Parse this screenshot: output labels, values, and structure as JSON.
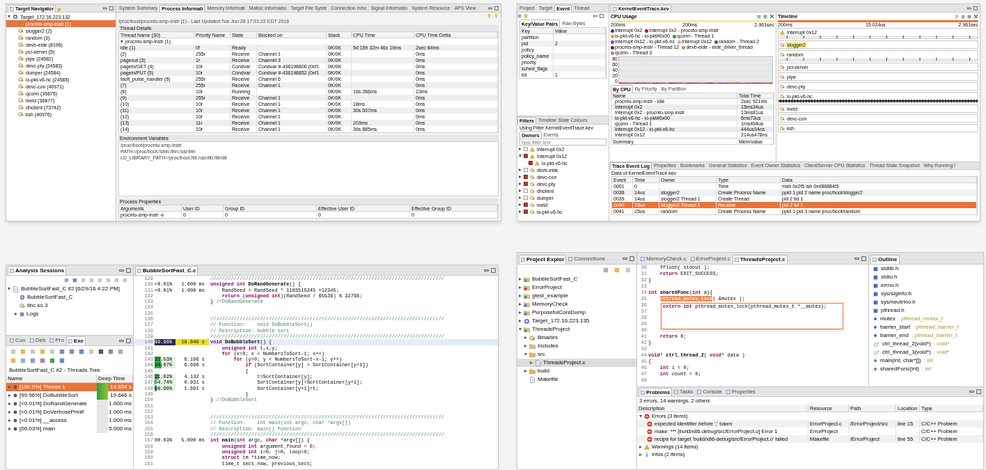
{
  "screen_1": {
    "navigator": {
      "tab": {
        "label": "Target Navigator",
        "selected": true
      },
      "tree": [
        {
          "label": "Target_172.16.223.132",
          "kind": "target",
          "expanded": true,
          "selected": false,
          "children": [
            {
              "label": "procnto-smp-instr (1)",
              "kind": "process",
              "selected": true
            },
            {
              "label": "slogger2 (2)",
              "kind": "process",
              "selected": false
            },
            {
              "label": "random (3)",
              "kind": "process",
              "selected": false
            },
            {
              "label": "devb-eide (8196)",
              "kind": "process",
              "selected": false
            },
            {
              "label": "pci-server (5)",
              "kind": "process",
              "selected": false
            },
            {
              "label": "pipe (24582)",
              "kind": "process",
              "selected": false
            },
            {
              "label": "devc-pty (24583)",
              "kind": "process",
              "selected": false
            },
            {
              "label": "dumper (24584)",
              "kind": "process",
              "selected": false
            },
            {
              "label": "io-pkt-v6-hc (24585)",
              "kind": "process",
              "selected": false
            },
            {
              "label": "devc-con (40971)",
              "kind": "process",
              "selected": false
            },
            {
              "label": "qconn (36876)",
              "kind": "process",
              "selected": false
            },
            {
              "label": "inetd (36877)",
              "kind": "process",
              "selected": false
            },
            {
              "label": "dhclient (73742)",
              "kind": "process",
              "selected": false
            },
            {
              "label": "ksh (40976)",
              "kind": "process",
              "selected": false
            }
          ]
        }
      ]
    },
    "tabs": [
      {
        "label": "System Summary",
        "selected": false
      },
      {
        "label": "Process Informati",
        "selected": true
      },
      {
        "label": "Memory Informati",
        "selected": false
      },
      {
        "label": "Malloc Informatio",
        "selected": false
      },
      {
        "label": "Target File Syste",
        "selected": false
      },
      {
        "label": "Connection Infor",
        "selected": false
      },
      {
        "label": "Signal Informatio",
        "selected": false
      },
      {
        "label": "System Resource",
        "selected": false
      },
      {
        "label": "APS View",
        "selected": false
      }
    ],
    "path": "/proc/boot/procnto-smp-instr (1) - Last Updated:Tue Jun 28 17:01:22 EDT 2016",
    "thread_details": {
      "title": "Thread Details",
      "columns": [
        "Thread Name (30)",
        "Priority Name",
        "State",
        "Blocked on",
        "Stack",
        "CPU Time",
        "CPU Time Delta"
      ],
      "group": {
        "label": "procnto-smp-instr (1)",
        "expanded": true
      },
      "rows": [
        [
          "idle (1)",
          "0f",
          "Ready",
          null,
          "0K/0K",
          "5d 15h 32m 46s 19ms",
          "2sec 84ms"
        ],
        [
          "(2)",
          "255r",
          "Receive",
          "Channel 1",
          "0K/0K",
          null,
          "0ms"
        ],
        [
          "pageout (3)",
          "1r",
          "Receive",
          "Channel 3",
          "0K/0K",
          null,
          "0ms"
        ],
        [
          "pagein/GET (4)",
          "10r",
          "Condvar",
          "Condvar #-436198800 (0xf1",
          "0K/0K",
          null,
          "0ms"
        ],
        [
          "pagein/PUT (5)",
          "10r",
          "Condvar",
          "Condvar #-436198852 (0xf1",
          "0K/0K",
          null,
          "0ms"
        ],
        [
          "fault_pulse_handler (6)",
          "255r",
          "Receive",
          "Channel 6",
          "0K/0K",
          null,
          "0ms"
        ],
        [
          "(7)",
          "255r",
          "Receive",
          "Channel 1",
          "0K/0K",
          null,
          "0ms"
        ],
        [
          "(8)",
          "10r",
          "Running",
          null,
          "0K/0K",
          "16s 286ms",
          "23ms"
        ],
        [
          "(9)",
          "255r",
          "Receive",
          "Channel 1",
          "0K/0K",
          null,
          "0ms"
        ],
        [
          "(10)",
          "10r",
          "Receive",
          "Channel 1",
          "0K/0K",
          "18ms",
          "0ms"
        ],
        [
          "(11)",
          "10r",
          "Receive",
          "Channel 1",
          "0K/0K",
          "30s 537ms",
          "0ms"
        ],
        [
          "(12)",
          "10r",
          "Receive",
          "Channel 1",
          "0K/0K",
          null,
          "0ms"
        ],
        [
          "(13)",
          "11r",
          "Receive",
          "Channel 1",
          "0K/0K",
          "203ms",
          "0ms"
        ],
        [
          "(14)",
          "10r",
          "Receive",
          "Channel 1",
          "0K/0K",
          "36s 885ms",
          "0ms"
        ]
      ]
    },
    "environment": {
      "title": "Environment Variables",
      "lines": [
        "/proc/boot/procnto-smp-instr",
        "PATH=/proc/boot:/sbin:/bin:/usr/bin",
        "LD_LIBRARY_PATH=/proc/boot:/lib:/usr/lib:/lib/dll"
      ]
    },
    "process_properties": {
      "title": "Process Properties",
      "columns": [
        "Arguments",
        "User ID",
        "Group ID",
        "Effective User ID",
        "Effective Group ID"
      ],
      "rows": [
        [
          "procnto-smp-instr -v",
          "0",
          "0",
          "0",
          "0"
        ]
      ]
    }
  },
  "screen_2": {
    "event_view": {
      "tabs": [
        {
          "label": "Project",
          "selected": false
        },
        {
          "label": "Target",
          "selected": false
        },
        {
          "label": "Event",
          "selected": true
        },
        {
          "label": "Thread",
          "selected": false
        }
      ],
      "subtabs": [
        {
          "label": "Key/Value Pairs",
          "selected": true
        },
        {
          "label": "Raw Bytes",
          "selected": false
        }
      ],
      "columns": [
        "Key",
        "Value"
      ],
      "rows": [
        [
          "partition",
          null
        ],
        [
          "pid",
          "2"
        ],
        [
          "policy",
          null
        ],
        [
          "policy_name",
          null
        ],
        [
          "priority",
          null
        ],
        [
          "sched_flags",
          null
        ],
        [
          "tid",
          "1"
        ]
      ]
    },
    "filters": {
      "tabs": [
        {
          "label": "Filters",
          "selected": true
        },
        {
          "label": "Timeline State Colours",
          "selected": false
        }
      ],
      "caption": "Using Filter KernelEventTrace.kev",
      "subtabs": [
        {
          "label": "Owners",
          "selected": true
        },
        {
          "label": "Events",
          "selected": false
        }
      ],
      "placeholder": "type filter text",
      "tree": [
        {
          "label": "Interrupt 0x2",
          "kind": "interrupt",
          "expanded": false,
          "checked": false
        },
        {
          "label": "Interrupt 0x12",
          "kind": "interrupt",
          "expanded": true,
          "checked": true,
          "children": [
            {
              "label": "io-pkt-v6-hc",
              "kind": "interrupt",
              "checked": true
            }
          ]
        },
        {
          "label": "devb-eide",
          "kind": "process",
          "expanded": false,
          "checked": false
        },
        {
          "label": "devc-con",
          "kind": "process",
          "expanded": false,
          "checked": true
        },
        {
          "label": "devc-pty",
          "kind": "process",
          "expanded": false,
          "checked": true
        },
        {
          "label": "dhclient",
          "kind": "process",
          "expanded": false,
          "checked": false
        },
        {
          "label": "dumper",
          "kind": "process",
          "expanded": false,
          "checked": false
        },
        {
          "label": "inetd",
          "kind": "process",
          "expanded": false,
          "checked": true
        },
        {
          "label": "io-pkt-v6-hc",
          "kind": "process",
          "expanded": false,
          "checked": true
        }
      ]
    },
    "editor_tab": {
      "label": "KernelEventTrace.kev",
      "selected": true
    },
    "cpu_usage": {
      "title": "CPU Usage",
      "axis": [
        "200ms",
        "200ms",
        "2.961sec"
      ],
      "legend": [
        {
          "name": "Interrupt 0x2",
          "color": "#2d3f9e"
        },
        {
          "name": "Interrupt 0x2 - procnto-smp-instr",
          "color": "#d0021b"
        },
        {
          "name": "io-pkt-v6-hc - io-pkt#0x00",
          "color": "#e8a317"
        },
        {
          "name": "qconn - Thread 1",
          "color": "#2e8b3a"
        },
        {
          "name": "Interrupt 0x12 - io-pkt-v6-hc",
          "color": "#8e3a9e"
        },
        {
          "name": "Interrupt 0x12",
          "color": "#e8a0b0"
        },
        {
          "name": "random - Thread 2",
          "color": "#555555"
        },
        {
          "name": "procnto-smp-instr - Thread 12",
          "color": "#5a1a8a"
        },
        {
          "name": "devb-eide - eide_driver_thread",
          "color": "#e8822a"
        },
        {
          "name": "qconn - Thread 3",
          "color": "#d9707a"
        }
      ],
      "y_labels": [
        "80",
        "60",
        "40",
        "20",
        "0"
      ],
      "tabs": [
        {
          "label": "By CPU",
          "selected": true
        },
        {
          "label": "By Priority",
          "selected": false
        },
        {
          "label": "By Partition",
          "selected": false
        }
      ],
      "columns": [
        "Name",
        "Total Time"
      ],
      "rows": [
        [
          "procnto-smp-instr - idle",
          "2sec 921ms"
        ],
        [
          "Interrupt 0x2",
          "15ms34us"
        ],
        [
          "Interrupt 0x2 - procnto-smp-instr",
          "13ms81us"
        ],
        [
          "io-pkt-v6-hc - io-pkt#0x00",
          "6ms73us"
        ],
        [
          "qconn - Thread 1",
          "1ms494us"
        ],
        [
          "Interrupt 0x12 - io-pkt-v6-hc",
          "444us34ns"
        ],
        [
          "Interrupt 0x12",
          "214us478ns"
        ]
      ],
      "summary": [
        "Summary",
        "Mem/value"
      ]
    },
    "timeline": {
      "title": "Timeline",
      "axis": [
        "200ms",
        "15.024us",
        "2.961sec"
      ],
      "rows": [
        {
          "label": "Interrupt 0x12",
          "kind": "interrupt",
          "events": {
            "dense": false
          },
          "highlighted": false
        },
        {
          "label": "slogger2",
          "kind": "process",
          "highlighted": true
        },
        {
          "label": "random",
          "kind": "process",
          "events": {
            "dense": false
          },
          "highlighted": false
        },
        {
          "label": "pci-server",
          "kind": "process",
          "highlighted": false
        },
        {
          "label": "pipe",
          "kind": "process",
          "highlighted": false
        },
        {
          "label": "devc-pty",
          "kind": "process",
          "highlighted": false
        },
        {
          "label": "io-pkt-v6-hc",
          "kind": "process",
          "events": {
            "dense": true
          },
          "highlighted": false
        },
        {
          "label": "inetd",
          "kind": "process",
          "highlighted": false
        },
        {
          "label": "devc-con",
          "kind": "process",
          "highlighted": false
        },
        {
          "label": "ksh",
          "kind": "process",
          "highlighted": false
        }
      ]
    },
    "trace_log": {
      "tabs": [
        {
          "label": "Trace Event Log",
          "selected": true
        },
        {
          "label": "Properties",
          "selected": false
        },
        {
          "label": "Bookmarks",
          "selected": false
        },
        {
          "label": "General Statistics",
          "selected": false
        },
        {
          "label": "Event Owner Statistics",
          "selected": false
        },
        {
          "label": "Client/Server CPU Statistics",
          "selected": false
        },
        {
          "label": "Thread State Snapshot",
          "selected": false
        },
        {
          "label": "Why Running?",
          "selected": false
        }
      ],
      "caption": "Data of KernelEventTrace.kev",
      "columns": [
        "Event",
        "Time",
        "Owner",
        "Type",
        "Data"
      ],
      "rows": [
        {
          "cells": [
            "0001",
            "0",
            null,
            "Time",
            "msb 0x2f5 lsb 0xd88884f3"
          ],
          "selected": false
        },
        {
          "cells": [
            "0038",
            "14us",
            "slogger2",
            "Create Process Name",
            "ppid 1 pid 2 name proc/boot/slogger2"
          ],
          "selected": false
        },
        {
          "cells": [
            "0039",
            "14us",
            "slogger2 Thread 1",
            "Create Thread",
            "pid 2 tid 1"
          ],
          "selected": false
        },
        {
          "cells": [
            "0040",
            "15us",
            "slogger2 Thread 1",
            "Receive",
            "pid 2 tid 1"
          ],
          "selected": true
        },
        {
          "cells": [
            "0041",
            "15us",
            "random",
            "Create Process Name",
            "ppid 1 pid 3 name proc/boot/random"
          ],
          "selected": false
        }
      ]
    }
  },
  "screen_3": {
    "sessions": {
      "tab": {
        "label": "Analysis Sessions",
        "selected": true
      },
      "tree": [
        {
          "label": "BubbleSortFast_C #2 [6/29/16 4:22 PM]",
          "kind": "session",
          "expanded": true,
          "children": [
            {
              "label": "BubbleSortFast_C",
              "kind": "binary"
            },
            {
              "label": "libc.so.3",
              "kind": "library"
            },
            {
              "label": "Logs",
              "kind": "logs",
              "expanded": false
            }
          ]
        }
      ]
    },
    "profiler": {
      "tabs": [
        {
          "label": "Con",
          "selected": false
        },
        {
          "label": "Deb",
          "selected": false
        },
        {
          "label": "Pro",
          "selected": false
        },
        {
          "label": "Exe",
          "selected": true
        }
      ],
      "caption": "BubbleSortFast_C #2 - Threads Tree",
      "columns": [
        "Name",
        "Deep Time"
      ],
      "rows": [
        {
          "label": "[100.0%] Thread 1",
          "time": "19.654 s",
          "level": 1,
          "selected": true,
          "expanded": false
        },
        {
          "label": "[99.96%] DoBubbleSort",
          "time": "19.646 s",
          "level": 0.9996,
          "selected": false,
          "expanded": false
        },
        {
          "label": "[<0.01%] DoRandGenerate",
          "time": "1.000 ms",
          "level": 0,
          "selected": false,
          "expanded": false
        },
        {
          "label": "[<0.01%] DoVerbosePrintf",
          "time": "1.000 ms",
          "level": 0,
          "selected": false,
          "expanded": false
        },
        {
          "label": "[<0.01%] __access",
          "time": "1.000 ms",
          "level": 0,
          "selected": false,
          "expanded": false
        },
        {
          "label": "[00.03%] main",
          "time": "5.000 ms",
          "level": 0,
          "selected": false,
          "expanded": false
        }
      ]
    },
    "editor": {
      "tab": {
        "label": "BubbleSortFast_C.c",
        "selected": true
      },
      "lines": [
        {
          "n": "129",
          "highlighted": false,
          "seg": [
            {
              "kind": "comment",
              "text": "////////////////////////////////////////////////////////////////////////////////"
            }
          ]
        },
        {
          "n": "130",
          "pct": "<0.01%",
          "time": "1.000 ms",
          "highlighted": false,
          "seg": [
            {
              "kind": "keyword",
              "text": "unsigned int "
            },
            {
              "kind": "name",
              "text": "DoRandGenerate"
            },
            {
              "kind": "plain",
              "text": "() {"
            }
          ]
        },
        {
          "n": "131",
          "pct": "<0.01%",
          "time": "1.000 ms",
          "highlighted": false,
          "seg": [
            {
              "kind": "plain",
              "text": "    RandSeed = RandSeed * 1103515245 +12345;"
            }
          ]
        },
        {
          "n": "132",
          "highlighted": false,
          "seg": [
            {
              "kind": "keyword",
              "text": "    return"
            },
            {
              "kind": "plain",
              "text": " ("
            },
            {
              "kind": "keyword",
              "text": "unsigned int"
            },
            {
              "kind": "plain",
              "text": ")(RandSeed / 65536) % 32768;"
            }
          ]
        },
        {
          "n": "133",
          "highlighted": false,
          "seg": [
            {
              "kind": "plain",
              "text": "} "
            },
            {
              "kind": "comment",
              "text": "//DoRandGenerate"
            }
          ]
        },
        {
          "n": "134",
          "highlighted": false
        },
        {
          "n": "135",
          "highlighted": false
        },
        {
          "n": "136",
          "highlighted": false,
          "seg": [
            {
              "kind": "comment",
              "text": "////////////////////////////////////////////////////////////////////////////////"
            }
          ]
        },
        {
          "n": "137",
          "highlighted": false,
          "seg": [
            {
              "kind": "comment",
              "text": "// Function:    void DoBubbleSort()"
            }
          ]
        },
        {
          "n": "138",
          "highlighted": false,
          "seg": [
            {
              "kind": "comment",
              "text": "// Description: bubble sort"
            }
          ]
        },
        {
          "n": "139",
          "highlighted": false,
          "seg": [
            {
              "kind": "comment",
              "text": "////////////////////////////////////////////////////////////////////////////////"
            }
          ]
        },
        {
          "n": "140",
          "pct": "99.96%",
          "time": "19.646 s",
          "level": 0.9996,
          "highlighted": true,
          "seg": [
            {
              "kind": "keyword",
              "text": "void "
            },
            {
              "kind": "name",
              "text": "DoBubbleSort"
            },
            {
              "kind": "plain",
              "text": "() {"
            }
          ]
        },
        {
          "n": "141",
          "highlighted": false,
          "seg": [
            {
              "kind": "keyword",
              "text": "    unsigned int"
            },
            {
              "kind": "plain",
              "text": " t,x,y;"
            }
          ]
        },
        {
          "n": "142",
          "highlighted": false,
          "seg": [
            {
              "kind": "keyword",
              "text": "    for"
            },
            {
              "kind": "plain",
              "text": " (x=0; x < NumbersToSort-1; x++)"
            }
          ]
        },
        {
          "n": "143",
          "pct": "31.53%",
          "time": "6.196 s",
          "level": 0.3153,
          "highlighted": false,
          "seg": [
            {
              "kind": "keyword",
              "text": "        for"
            },
            {
              "kind": "plain",
              "text": " (y=0; y < NumbersToSort-x-1; y++)"
            }
          ]
        },
        {
          "n": "144",
          "pct": "34.07%",
          "time": "6.696 s",
          "level": 0.3407,
          "highlighted": false,
          "seg": [
            {
              "kind": "keyword",
              "text": "            if"
            },
            {
              "kind": "plain",
              "text": " (SortContainer[y] > SortContainer[y+1])"
            }
          ]
        },
        {
          "n": "145",
          "highlighted": false,
          "seg": [
            {
              "kind": "plain",
              "text": "            {"
            }
          ]
        },
        {
          "n": "146",
          "pct": "21.02%",
          "time": "4.132 s",
          "level": 0.2102,
          "highlighted": false,
          "seg": [
            {
              "kind": "plain",
              "text": "                t=SortContainer[y];"
            }
          ]
        },
        {
          "n": "147",
          "pct": "04.74%",
          "time": "0.931 s",
          "level": 0.0474,
          "highlighted": false,
          "seg": [
            {
              "kind": "plain",
              "text": "                SortContainer[y]=SortContainer[y+1];"
            }
          ]
        },
        {
          "n": "148",
          "pct": "08.60%",
          "time": "1.691 s",
          "level": 0.086,
          "highlighted": false,
          "seg": [
            {
              "kind": "plain",
              "text": "                SortContainer[y+1]=t;"
            }
          ]
        },
        {
          "n": "149",
          "highlighted": false,
          "seg": [
            {
              "kind": "plain",
              "text": "            }"
            }
          ]
        },
        {
          "n": "150",
          "highlighted": false,
          "seg": [
            {
              "kind": "plain",
              "text": "} "
            },
            {
              "kind": "comment",
              "text": "//DoBubbleSort"
            }
          ]
        },
        {
          "n": "151",
          "highlighted": false
        },
        {
          "n": "152",
          "highlighted": false
        },
        {
          "n": "153",
          "highlighted": false,
          "seg": [
            {
              "kind": "comment",
              "text": "////////////////////////////////////////////////////////////////////////////////"
            }
          ]
        },
        {
          "n": "154",
          "highlighted": false,
          "seg": [
            {
              "kind": "comment",
              "text": "// Function:    int main(int argc, char *argv[])"
            }
          ]
        },
        {
          "n": "155",
          "highlighted": false,
          "seg": [
            {
              "kind": "comment",
              "text": "// Description: main() function"
            }
          ]
        },
        {
          "n": "156",
          "highlighted": false,
          "seg": [
            {
              "kind": "comment",
              "text": "////////////////////////////////////////////////////////////////////////////////"
            }
          ]
        },
        {
          "n": "157",
          "pct": "00.03%",
          "time": "5.000 ms",
          "highlighted": false,
          "seg": [
            {
              "kind": "keyword",
              "text": "int "
            },
            {
              "kind": "name",
              "text": "main"
            },
            {
              "kind": "plain",
              "text": "("
            },
            {
              "kind": "keyword",
              "text": "int"
            },
            {
              "kind": "plain",
              "text": " argc, "
            },
            {
              "kind": "keyword",
              "text": "char"
            },
            {
              "kind": "plain",
              "text": " *argv[]) {"
            }
          ]
        },
        {
          "n": "158",
          "highlighted": false,
          "seg": [
            {
              "kind": "keyword",
              "text": "    unsigned int"
            },
            {
              "kind": "plain",
              "text": " argument_found = 0;"
            }
          ]
        },
        {
          "n": "159",
          "highlighted": false,
          "seg": [
            {
              "kind": "keyword",
              "text": "    unsigned int"
            },
            {
              "kind": "plain",
              "text": " i=0, j=0, loop=0;"
            }
          ]
        },
        {
          "n": "160",
          "highlighted": false,
          "seg": [
            {
              "kind": "keyword",
              "text": "    struct"
            },
            {
              "kind": "plain",
              "text": " tm *time_now;"
            }
          ]
        },
        {
          "n": "161",
          "highlighted": false,
          "seg": [
            {
              "kind": "plain",
              "text": "    time_t secs_now, previous_secs;"
            }
          ]
        }
      ]
    }
  },
  "screen_4": {
    "explorer": {
      "tabs": [
        {
          "label": "Project Explor",
          "selected": true
        },
        {
          "label": "Connections",
          "selected": false
        }
      ],
      "tree": [
        {
          "label": "BubbleSortFast_C",
          "kind": "project",
          "expanded": false,
          "selected": false
        },
        {
          "label": "ErrorProject",
          "kind": "error_project",
          "expanded": false,
          "selected": false
        },
        {
          "label": "gtest_example",
          "kind": "project",
          "expanded": false,
          "selected": false
        },
        {
          "label": "MemoryCheck",
          "kind": "project",
          "expanded": false,
          "selected": false
        },
        {
          "label": "PurposefulCoreDump",
          "kind": "project",
          "expanded": false,
          "selected": false
        },
        {
          "label": "Target_172.16.223.135",
          "kind": "target",
          "expanded": false,
          "selected": false
        },
        {
          "label": "ThreadsProject",
          "kind": "project",
          "expanded": true,
          "selected": false,
          "children": [
            {
              "label": "Binaries",
              "kind": "binaries",
              "expanded": false,
              "selected": false
            },
            {
              "label": "Includes",
              "kind": "includes",
              "expanded": false,
              "selected": false
            },
            {
              "label": "src",
              "kind": "folder",
              "expanded": true,
              "selected": false,
              "children": [
                {
                  "label": "ThreadsProject.c",
                  "kind": "file",
                  "expanded": false,
                  "selected": true
                }
              ]
            },
            {
              "label": "build",
              "kind": "folder",
              "expanded": false,
              "selected": false
            },
            {
              "label": "Makefile",
              "kind": "file",
              "selected": false
            }
          ]
        }
      ]
    },
    "editor": {
      "tabs": [
        {
          "label": "MemoryCheck.c",
          "selected": false
        },
        {
          "label": "ErrorProject.c",
          "selected": false
        },
        {
          "label": "ThreadsProject.c",
          "selected": true
        }
      ],
      "lines": [
        {
          "n": "30",
          "seg": [
            {
              "kind": "plain",
              "text": "    fflush( stdout );"
            }
          ]
        },
        {
          "n": "31",
          "seg": [
            {
              "kind": "keyword",
              "text": "    return"
            },
            {
              "kind": "plain",
              "text": " EXIT_SUCCESS;"
            }
          ]
        },
        {
          "n": "32",
          "seg": [
            {
              "kind": "plain",
              "text": "}"
            }
          ]
        },
        {
          "n": "33"
        },
        {
          "n": "34",
          "seg": [
            {
              "kind": "keyword",
              "text": "int "
            },
            {
              "kind": "name",
              "text": "sharedFunc"
            },
            {
              "kind": "plain",
              "text": "("
            },
            {
              "kind": "keyword",
              "text": "int"
            },
            {
              "kind": "plain",
              "text": " a){"
            }
          ]
        },
        {
          "n": "35",
          "seg": [
            {
              "kind": "selection",
              "text": "    pthread_mutex_lock"
            },
            {
              "kind": "plain",
              "text": "( &mutex );"
            }
          ]
        },
        {
          "n": "36"
        },
        {
          "n": "37"
        },
        {
          "n": "38"
        },
        {
          "n": "39"
        },
        {
          "n": "40"
        },
        {
          "n": "41",
          "seg": [
            {
              "kind": "keyword",
              "text": "    return"
            },
            {
              "kind": "plain",
              "text": " 0;"
            }
          ]
        },
        {
          "n": "42",
          "seg": [
            {
              "kind": "plain",
              "text": "}"
            }
          ]
        },
        {
          "n": "43"
        },
        {
          "n": "44",
          "seg": [
            {
              "kind": "keyword",
              "text": "void"
            },
            {
              "kind": "plain",
              "text": "* "
            },
            {
              "kind": "name",
              "text": "ctrl_thread_2"
            },
            {
              "kind": "plain",
              "text": "( "
            },
            {
              "kind": "keyword",
              "text": "void"
            },
            {
              "kind": "plain",
              "text": "* data )"
            }
          ]
        },
        {
          "n": "45",
          "seg": [
            {
              "kind": "plain",
              "text": "{"
            }
          ]
        },
        {
          "n": "46",
          "seg": [
            {
              "kind": "keyword",
              "text": "    int"
            },
            {
              "kind": "plain",
              "text": " i = 0;"
            }
          ]
        },
        {
          "n": "47",
          "seg": [
            {
              "kind": "keyword",
              "text": "    int"
            },
            {
              "kind": "plain",
              "text": " count = 0;"
            }
          ]
        },
        {
          "n": "48"
        }
      ],
      "hover": [
        {
          "kind": "keyword",
          "text": "extern int "
        },
        {
          "kind": "plain",
          "text": "pthread_mutex_lock(pthread_mutex_t *__mutex);"
        }
      ]
    },
    "outline": {
      "tab": {
        "label": "Outline",
        "selected": true
      },
      "items": [
        {
          "kind": "include",
          "name": "stdlib.h"
        },
        {
          "kind": "include",
          "name": "stdio.h"
        },
        {
          "kind": "include",
          "name": "errno.h"
        },
        {
          "kind": "include",
          "name": "sys/siginfo.h"
        },
        {
          "kind": "include",
          "name": "sys/neutrino.h"
        },
        {
          "kind": "include",
          "name": "pthread.h"
        },
        {
          "kind": "variable",
          "name": "mutex",
          "type": ": pthread_mutex_t"
        },
        {
          "kind": "variable",
          "name": "barrier_start",
          "type": ": pthread_barrier_t"
        },
        {
          "kind": "variable",
          "name": "barrier_end",
          "type": ": pthread_barrier_t"
        },
        {
          "kind": "static_function",
          "name": "ctrl_thread_2(void*)",
          "type": ": void*"
        },
        {
          "kind": "static_function",
          "name": "ctrl_thread_3(void*)",
          "type": ": void*"
        },
        {
          "kind": "function",
          "name": "main(int, char*[])",
          "type": ": int"
        },
        {
          "kind": "function",
          "name": "sharedFunc(int)",
          "type": ": int"
        }
      ]
    },
    "problems": {
      "tabs": [
        {
          "label": "Problems",
          "selected": true
        },
        {
          "label": "Tasks",
          "selected": false
        },
        {
          "label": "Console",
          "selected": false
        },
        {
          "label": "Properties",
          "selected": false
        }
      ],
      "caption": "3 errors, 14 warnings, 2 others",
      "columns": [
        "Description",
        "Resource",
        "Path",
        "Location",
        "Type"
      ],
      "groups": [
        {
          "label": "Errors (3 items)",
          "kind": "error",
          "expanded": true,
          "rows": [
            [
              "expected identifier before ';' token",
              "ErrorProject.c",
              "/ErrorProject/src",
              "line 15",
              "C/C++ Problem"
            ],
            [
              "make: *** [build/x86-debug/src/ErrorProject.o] Error 1",
              "ErrorProject",
              null,
              null,
              "C/C++ Problem"
            ],
            [
              "recipe for target 'build/x86-debug/src/ErrorProject.o' failed",
              "Makefile",
              "/ErrorProject",
              "line 55",
              "C/C++ Problem"
            ]
          ]
        },
        {
          "label": "Warnings (14 items)",
          "kind": "warning",
          "expanded": false
        },
        {
          "label": "Infos (2 items)",
          "kind": "info",
          "expanded": false
        }
      ]
    }
  }
}
